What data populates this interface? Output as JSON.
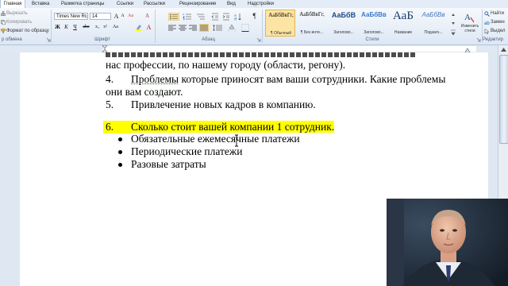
{
  "ribbon_tabs": [
    "Главная",
    "Вставка",
    "Разметка страницы",
    "Ссылки",
    "Рассылки",
    "Рецензирование",
    "Вид",
    "Надстройки"
  ],
  "clipboard": {
    "cut": "Вырезать",
    "copy": "Копировать",
    "format_painter": "Формат по образцу",
    "group_label": "р обмена"
  },
  "font": {
    "name": "Times New Rc",
    "size": "14",
    "group_label": "Шрифт"
  },
  "paragraph": {
    "group_label": "Абзац"
  },
  "styles": {
    "group_label": "Стили",
    "items": [
      {
        "preview": "АаБбВвГг,",
        "name": "¶ Обычный"
      },
      {
        "preview": "АаБбВвГг,",
        "name": "¶ Без инте..."
      },
      {
        "preview": "АаБбВ",
        "name": "Заголово..."
      },
      {
        "preview": "АаБбВв",
        "name": "Заголово..."
      },
      {
        "preview": "АаБ",
        "name": "Название"
      },
      {
        "preview": "АаБбВв",
        "name": "Подзаго..."
      }
    ],
    "change_styles": "Изменить стили"
  },
  "editing": {
    "find": "Найти",
    "replace": "Замен",
    "select": "Выдел",
    "group_label": "Редактир"
  },
  "document": {
    "line_partial_1": "нас профессии, по нашему городу (области, регону).",
    "item4_num": "4.",
    "item4_word": "Проблемы",
    "item4_rest": " которые приносят вам ваши сотрудники. Какие проблемы",
    "item4_cont": "они вам создают.",
    "item5_num": "5.",
    "item5_text": "Привлечение новых кадров в компанию.",
    "item6_num": "6.",
    "item6_text": "Сколько стоит вашей компании 1 сотрудник.",
    "bullets": [
      "Обязательные ежемесячные платежи",
      "Периодические платежи",
      "Разовые затраты"
    ]
  },
  "colors": {
    "highlight": "#ffff00",
    "ribbon_bg": "#dde7f4",
    "accent": "#2b579a"
  }
}
